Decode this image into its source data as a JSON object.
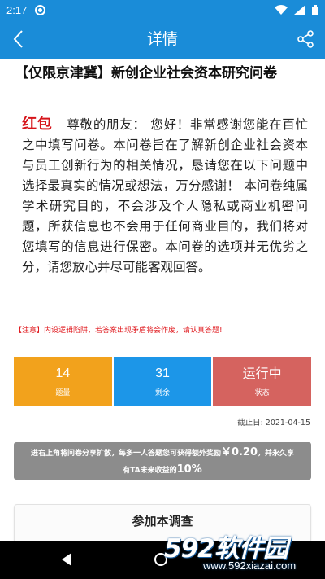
{
  "status_bar": {
    "time": "2:17"
  },
  "header": {
    "title": "详情",
    "back_icon": "chevron-left-icon",
    "share_icon": "share-icon",
    "color": "#1a8cd8"
  },
  "survey": {
    "title": "【仅限京津冀】新创企业社会资本研究问卷",
    "red_packet_label": "红包",
    "intro": "尊敬的朋友： 您好！非常感谢您能在百忙之中填写问卷。本问卷旨在了解新创企业社会资本与员工创新行为的相关情况，恳请您在以下问题中选择最真实的情况或想法，万分感谢！ 本问卷纯属学术研究目的，不会涉及个人隐私或商业机密问题，所获信息也不会用于任何商业目的，我们将对您填写的信息进行保密。本问卷的选项并无优劣之分，请您放心并尽可能客观回答。",
    "notice": "【注意】内设逻辑陷阱，若答案出现矛盾将会作废，请认真答题!"
  },
  "stats": [
    {
      "value": "14",
      "label": "题量",
      "color": "#f2a21c"
    },
    {
      "value": "31",
      "label": "剩余",
      "color": "#1c96e8"
    },
    {
      "value": "运行中",
      "label": "状态",
      "color": "#d5635f"
    }
  ],
  "deadline": "截止日: 2021-04-15",
  "share_promo": {
    "line1_prefix": "进右上角将问卷分享扩散，每多一人答题您可获得额外奖励",
    "amount": "￥0.20",
    "line1_suffix": "，并永久享",
    "line2_prefix": "有TA未来收益的",
    "percent": "10%"
  },
  "join_button": "参加本调查",
  "watermark": {
    "brand": "592软件园",
    "url": "www.592xiazai.com"
  }
}
